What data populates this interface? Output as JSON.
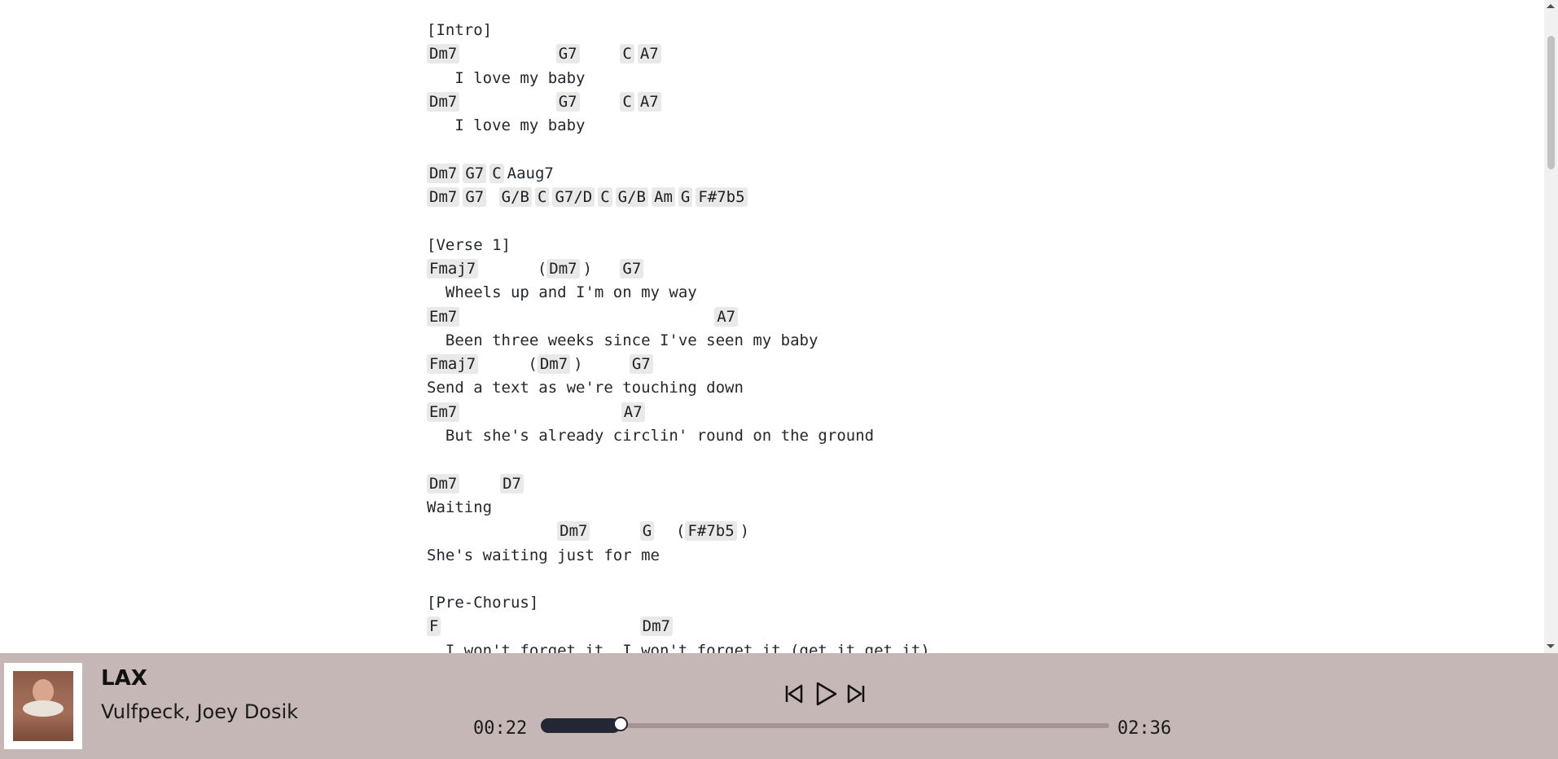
{
  "sheet": {
    "lines": [
      [
        {
          "t": "[Intro]"
        }
      ],
      [
        {
          "c": "Dm7"
        },
        {
          "t": "          "
        },
        {
          "c": "G7"
        },
        {
          "t": "    "
        },
        {
          "c": "C"
        },
        {
          "c": "A7"
        }
      ],
      [
        {
          "t": "   I love my baby"
        }
      ],
      [
        {
          "c": "Dm7"
        },
        {
          "t": "          "
        },
        {
          "c": "G7"
        },
        {
          "t": "    "
        },
        {
          "c": "C"
        },
        {
          "c": "A7"
        }
      ],
      [
        {
          "t": "   I love my baby"
        }
      ],
      [],
      [
        {
          "c": "Dm7"
        },
        {
          "c": "G7"
        },
        {
          "c": "C"
        },
        {
          "t": "Aaug7"
        }
      ],
      [
        {
          "c": "Dm7"
        },
        {
          "c": "G7"
        },
        {
          "t": " "
        },
        {
          "c": "G/B"
        },
        {
          "c": "C"
        },
        {
          "c": "G7/D"
        },
        {
          "c": "C"
        },
        {
          "c": "G/B"
        },
        {
          "c": "Am"
        },
        {
          "c": "G"
        },
        {
          "c": "F#7b5"
        }
      ],
      [],
      [
        {
          "t": "[Verse 1]"
        }
      ],
      [
        {
          "c": "Fmaj7"
        },
        {
          "t": "      ("
        },
        {
          "c": "Dm7"
        },
        {
          "t": ")   "
        },
        {
          "c": "G7"
        }
      ],
      [
        {
          "t": "  Wheels up and I'm on my way"
        }
      ],
      [
        {
          "c": "Em7"
        },
        {
          "t": "                           "
        },
        {
          "c": "A7"
        }
      ],
      [
        {
          "t": "  Been three weeks since I've seen my baby"
        }
      ],
      [
        {
          "c": "Fmaj7"
        },
        {
          "t": "     ("
        },
        {
          "c": "Dm7"
        },
        {
          "t": ")     "
        },
        {
          "c": "G7"
        }
      ],
      [
        {
          "t": "Send a text as we're touching down"
        }
      ],
      [
        {
          "c": "Em7"
        },
        {
          "t": "                 "
        },
        {
          "c": "A7"
        }
      ],
      [
        {
          "t": "  But she's already circlin' round on the ground"
        }
      ],
      [],
      [
        {
          "c": "Dm7"
        },
        {
          "t": "    "
        },
        {
          "c": "D7"
        }
      ],
      [
        {
          "t": "Waiting"
        }
      ],
      [
        {
          "t": "              "
        },
        {
          "c": "Dm7"
        },
        {
          "t": "     "
        },
        {
          "c": "G"
        },
        {
          "t": "  ("
        },
        {
          "c": "F#7b5"
        },
        {
          "t": ")"
        }
      ],
      [
        {
          "t": "She's waiting just for me"
        }
      ],
      [],
      [
        {
          "t": "[Pre-Chorus]"
        }
      ],
      [
        {
          "c": "F"
        },
        {
          "t": "                     "
        },
        {
          "c": "Dm7"
        }
      ],
      [
        {
          "t": "  I won't forget it, I won't forget it (get it get it)"
        }
      ]
    ]
  },
  "player": {
    "title": "LAX",
    "artist": "Vulfpeck, Joey Dosik",
    "time_current": "00:22",
    "time_total": "02:36",
    "progress": 0.141,
    "cover_icon": "album-cover",
    "prev_icon": "skip-previous-icon",
    "play_icon": "play-icon",
    "next_icon": "skip-next-icon"
  },
  "colors": {
    "player_bg": "#c5b7b5",
    "chord_bg": "#e9e9e9",
    "progress_fill": "#232633",
    "text": "#23272f"
  }
}
